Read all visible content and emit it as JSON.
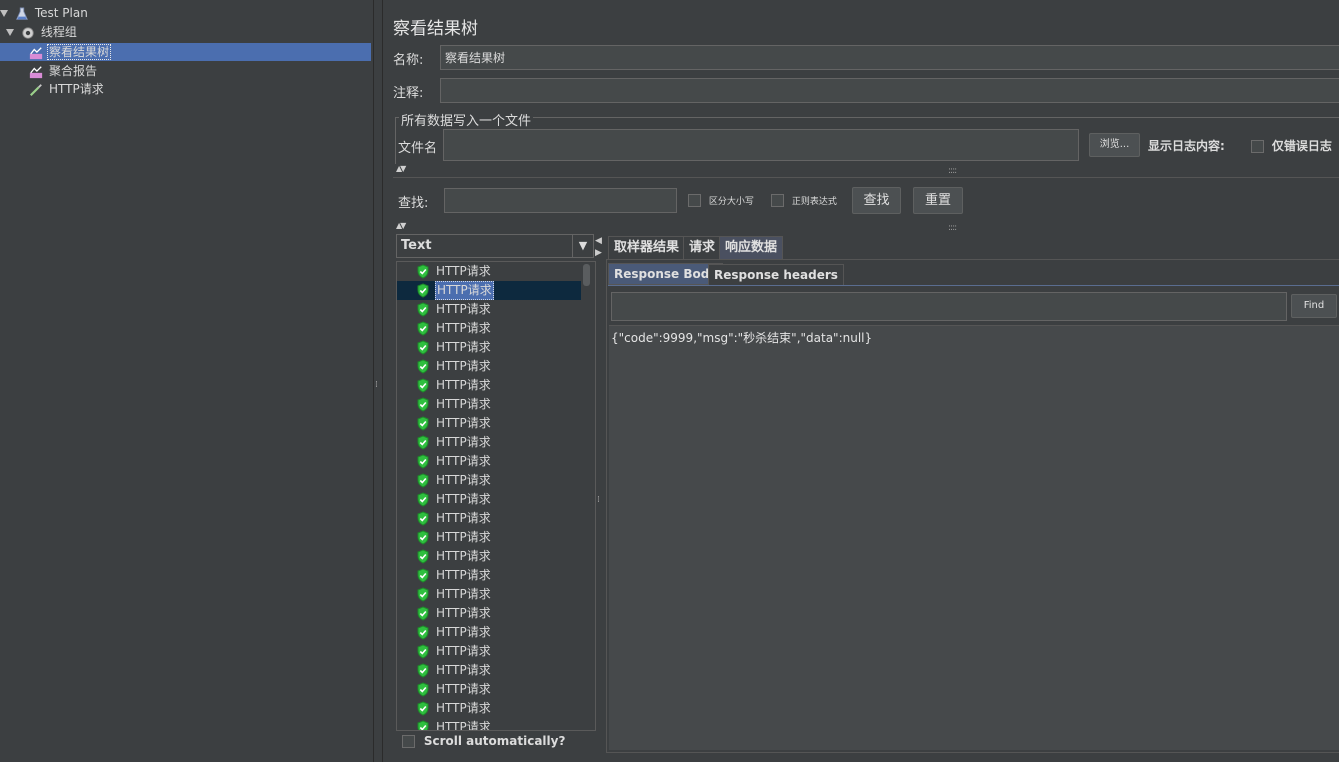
{
  "tree": {
    "items": [
      {
        "label": "Test Plan",
        "icon": "flask-icon"
      },
      {
        "label": "线程组",
        "icon": "gear-icon"
      },
      {
        "label": "察看结果树",
        "icon": "chart-icon"
      },
      {
        "label": "聚合报告",
        "icon": "chart-icon"
      },
      {
        "label": "HTTP请求",
        "icon": "pipette-icon"
      }
    ]
  },
  "panel": {
    "title": "察看结果树",
    "name_label": "名称:",
    "name_value": "察看结果树",
    "comment_label": "注释:",
    "comment_value": "",
    "group_title": "所有数据写入一个文件",
    "filename_label": "文件名",
    "filename_value": "",
    "browse_button": "浏览...",
    "log_content_label": "显示日志内容:",
    "errors_only_label": "仅错误日志"
  },
  "search": {
    "label": "查找:",
    "value": "",
    "case_label": "区分大小写",
    "regex_label": "正则表达式",
    "find_button": "查找",
    "reset_button": "重置"
  },
  "results": {
    "renderer": "Text",
    "items": [
      "HTTP请求",
      "HTTP请求",
      "HTTP请求",
      "HTTP请求",
      "HTTP请求",
      "HTTP请求",
      "HTTP请求",
      "HTTP请求",
      "HTTP请求",
      "HTTP请求",
      "HTTP请求",
      "HTTP请求",
      "HTTP请求",
      "HTTP请求",
      "HTTP请求",
      "HTTP请求",
      "HTTP请求",
      "HTTP请求",
      "HTTP请求",
      "HTTP请求",
      "HTTP请求",
      "HTTP请求",
      "HTTP请求",
      "HTTP请求",
      "HTTP请求",
      "HTTP请求"
    ],
    "scroll_label": "Scroll automatically?"
  },
  "detail": {
    "tabs": [
      "取样器结果",
      "请求",
      "响应数据"
    ],
    "subtabs": [
      "Response Body",
      "Response headers"
    ],
    "find_value": "",
    "find_button": "Find",
    "body": "{\"code\":9999,\"msg\":\"秒杀结束\",\"data\":null}"
  },
  "colors": {
    "background": "#3c3f41",
    "selection": "#4b6eaf",
    "success_icon": "#2fbf3f"
  }
}
